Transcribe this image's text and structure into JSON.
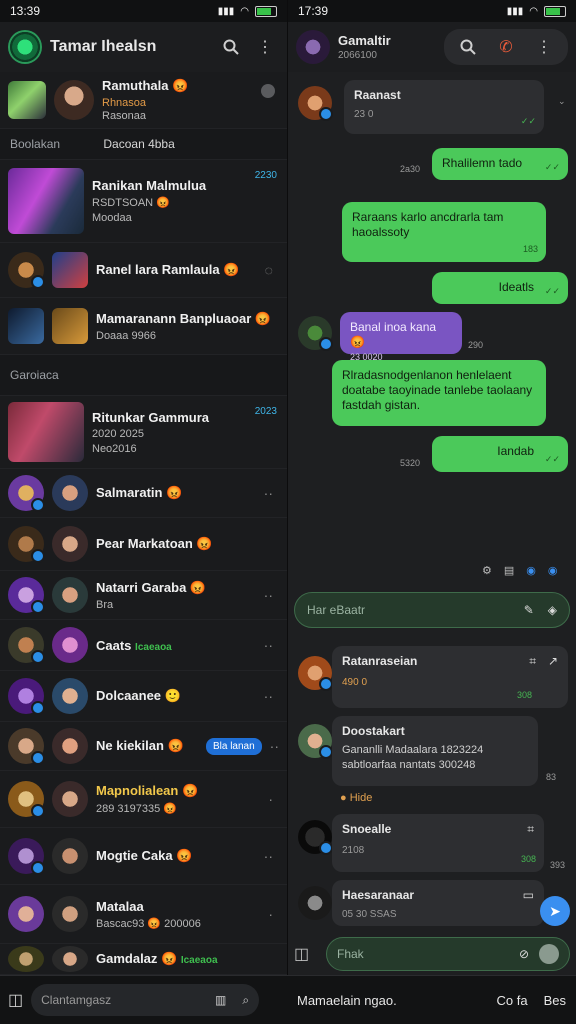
{
  "left": {
    "status": {
      "time": "13:39",
      "icons": "📶 ◉"
    },
    "app_title": "Tamar Ihealsn",
    "pinned": {
      "name": "Ramuthala 😡",
      "sub": "Rhnasoa",
      "sub2": "Rasonaa"
    },
    "section1": "Boolakan",
    "section1_right": "Dacoan 4bba",
    "section2": "Garoiaca",
    "rows": [
      {
        "name": "Ranikan Malmulua",
        "sub": "RSDTSOAN 😡",
        "sub2": "Moodaa",
        "time": "2230"
      },
      {
        "name": "Ranel lara Ramlaula 😡",
        "sub": ""
      },
      {
        "name": "Mamaranann Banpluaoar 😡",
        "sub": "Doaaa 9966"
      },
      {
        "name": "Ritunkar Gammura",
        "sub": "2020 2025",
        "sub2": "Neo2016",
        "time": "2023"
      },
      {
        "name": "Salmaratin 😡",
        "sub": ""
      },
      {
        "name": "Pear Markatoan 😡",
        "sub": ""
      },
      {
        "name": "Natarri Garaba 😡",
        "sub": "Bra"
      },
      {
        "name": "Caats",
        "sub": "Icaeaoa"
      },
      {
        "name": "Dolcaanee 🙂",
        "sub": ""
      },
      {
        "name": "Ne kiekilan 😡",
        "chip": "Bla lanan"
      },
      {
        "name": "Mapnolialean 😡",
        "sub": "289 3197335 😡"
      },
      {
        "name": "Mogtie Caka 😡",
        "sub": ""
      },
      {
        "name": "Matalaa",
        "sub": "Bascac93 😡 200006"
      },
      {
        "name": "Gamdalaz 😡",
        "sub": "Icaeaoa"
      }
    ],
    "search_placeholder": "Clantamgasz"
  },
  "right": {
    "status": {
      "time": "17:39"
    },
    "chat_name": "Gamaltir",
    "chat_sub": "2066100",
    "messages": [
      {
        "dir": "in",
        "text": "Raanast",
        "sub": "23 0",
        "time": ""
      },
      {
        "dir": "out",
        "text": "Rhalilemn tado",
        "side": "2a30"
      },
      {
        "dir": "out",
        "text": "Raraans karlo ancdrarla tam haoalssoty",
        "time": "183"
      },
      {
        "dir": "out",
        "text": "Ideatls"
      },
      {
        "dir": "purple",
        "text": "Banal inoa kana 😡",
        "sub": "23 0020",
        "side": "290"
      },
      {
        "dir": "out",
        "text": "Rlradasnodgenlanon henlelaent doatabe taoyinade tanlebe taolaany fastdah gistan."
      },
      {
        "dir": "out",
        "text": "Iandab",
        "side": "5320"
      },
      {
        "dir": "in",
        "text": "Ratanraseian",
        "sub": "490 0",
        "time": "308"
      },
      {
        "dir": "in",
        "text": "Doostakart",
        "sub": "Gananlli Madaalara 1823224 sabtloarfaa nantats 300248",
        "time": "",
        "side": "83"
      },
      {
        "dir": "in",
        "text": "Snoealle",
        "sub": "2108",
        "time": "308",
        "side": "393"
      },
      {
        "dir": "in",
        "text": "Haesaranaar",
        "sub": "05 30 SSAS"
      }
    ],
    "reaction": "Hide",
    "composer_top": "Har eBaatr",
    "composer_bottom": "Fhak",
    "bottom_label": "Mamaelain ngao.",
    "bottom_right1": "Co fa",
    "bottom_right2": "Bes"
  }
}
